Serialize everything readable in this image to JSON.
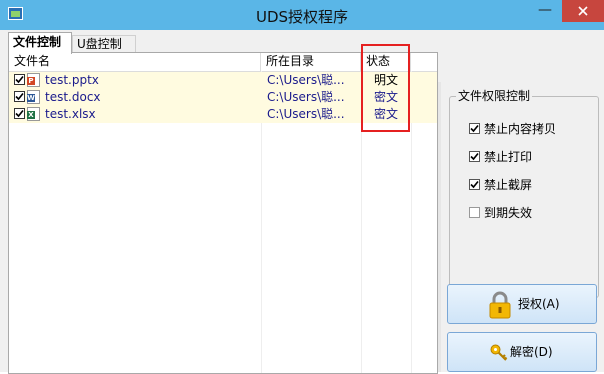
{
  "window": {
    "title": "UDS授权程序",
    "minimize_glyph": "—"
  },
  "tabs": [
    {
      "label": "文件控制"
    },
    {
      "label": "U盘控制"
    }
  ],
  "file_list": {
    "columns": [
      "文件名",
      "所在目录",
      "状态"
    ],
    "rows": [
      {
        "name": "test.pptx",
        "dir": "C:\\Users\\聪...",
        "status": "明文",
        "icon": "pptx-file-icon",
        "checked": true
      },
      {
        "name": "test.docx",
        "dir": "C:\\Users\\聪...",
        "status": "密文",
        "icon": "docx-file-icon",
        "checked": true
      },
      {
        "name": "test.xlsx",
        "dir": "C:\\Users\\聪...",
        "status": "密文",
        "icon": "xlsx-file-icon",
        "checked": true
      }
    ]
  },
  "permissions": {
    "title": "文件权限控制",
    "options": [
      {
        "label": "禁止内容拷贝",
        "checked": true
      },
      {
        "label": "禁止打印",
        "checked": true
      },
      {
        "label": "禁止截屏",
        "checked": true
      },
      {
        "label": "到期失效",
        "checked": false
      }
    ]
  },
  "buttons": {
    "authorize": "授权(A)",
    "decrypt": "解密(D)"
  },
  "colors": {
    "titlebar": "#5ab6e7",
    "close": "#c7463e",
    "highlight_box": "#e52020",
    "row_bg": "#fffbe0",
    "link_text": "#1a1a8c"
  }
}
